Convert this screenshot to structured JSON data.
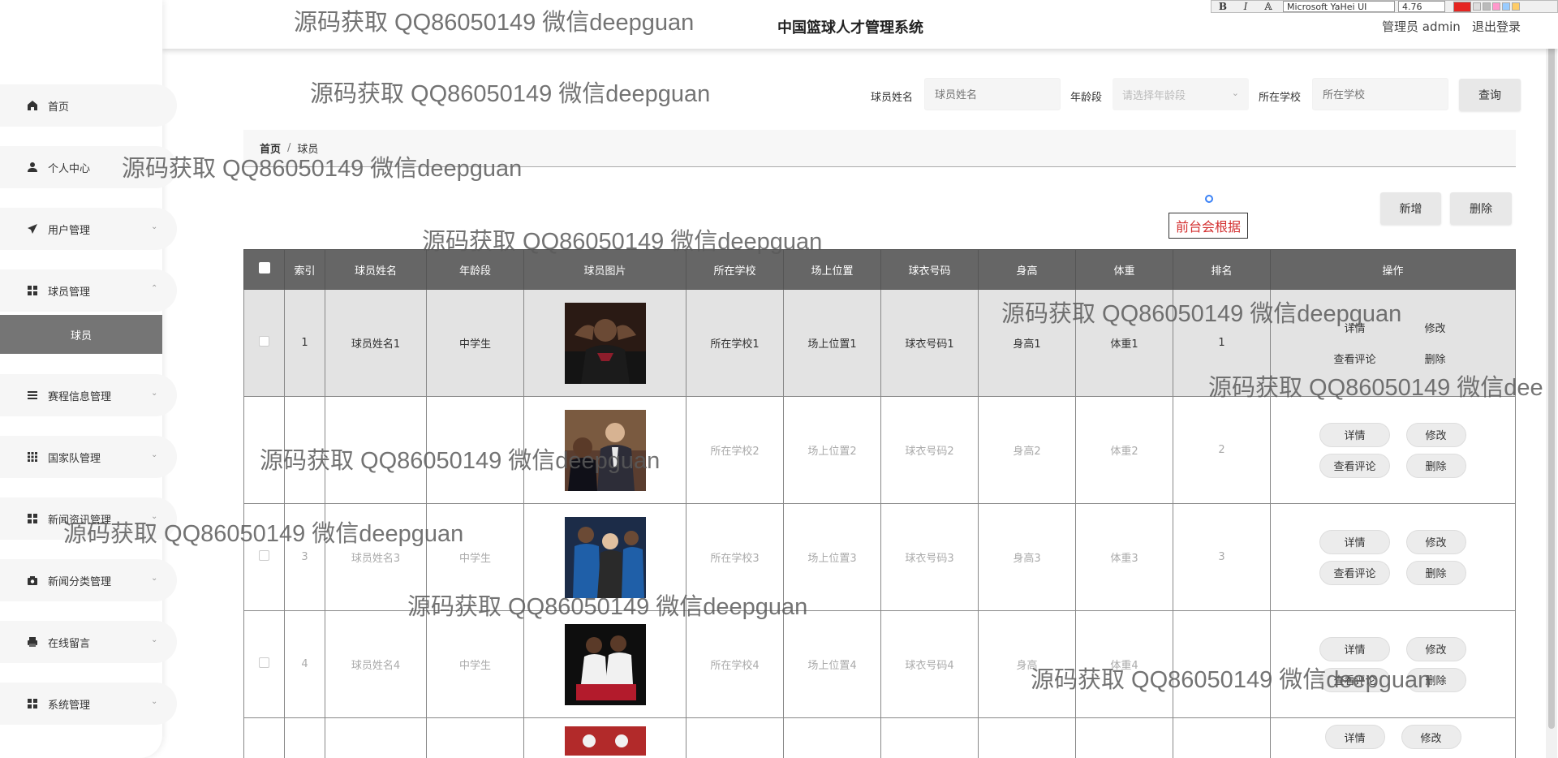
{
  "header": {
    "title": "中国篮球人才管理系统",
    "user": "管理员 admin",
    "logout": "退出登录"
  },
  "editor_toolbar": {
    "bold": "B",
    "italic": "I",
    "font": "Microsoft YaHei UI",
    "size": "4.76"
  },
  "sidebar": {
    "items": [
      {
        "label": "首页",
        "icon": "home-icon"
      },
      {
        "label": "个人中心",
        "icon": "user-icon"
      },
      {
        "label": "用户管理",
        "icon": "send-icon"
      },
      {
        "label": "球员管理",
        "icon": "grid-icon"
      },
      {
        "label": "赛程信息管理",
        "icon": "list-icon"
      },
      {
        "label": "国家队管理",
        "icon": "grid9-icon"
      },
      {
        "label": "新闻资讯管理",
        "icon": "grid-icon"
      },
      {
        "label": "新闻分类管理",
        "icon": "camera-icon"
      },
      {
        "label": "在线留言",
        "icon": "printer-icon"
      },
      {
        "label": "系统管理",
        "icon": "grid-icon"
      }
    ],
    "active_sub": "球员"
  },
  "search": {
    "name_label": "球员姓名",
    "name_placeholder": "球员姓名",
    "age_label": "年龄段",
    "age_placeholder": "请选择年龄段",
    "school_label": "所在学校",
    "school_placeholder": "所在学校",
    "query_button": "查询"
  },
  "breadcrumb": {
    "home": "首页",
    "separator": "/",
    "current": "球员"
  },
  "actions": {
    "add": "新增",
    "delete": "删除"
  },
  "note": "前台会根据",
  "table": {
    "headers": [
      "索引",
      "球员姓名",
      "年龄段",
      "球员图片",
      "所在学校",
      "场上位置",
      "球衣号码",
      "身高",
      "体重",
      "排名",
      "操作"
    ],
    "rows": [
      {
        "index": "1",
        "name": "球员姓名1",
        "age": "中学生",
        "school": "所在学校1",
        "position": "场上位置1",
        "jersey": "球衣号码1",
        "height": "身高1",
        "weight": "体重1",
        "rank": "1"
      },
      {
        "index": "",
        "name": "",
        "age": "",
        "school": "所在学校2",
        "position": "场上位置2",
        "jersey": "球衣号码2",
        "height": "身高2",
        "weight": "体重2",
        "rank": "2"
      },
      {
        "index": "3",
        "name": "球员姓名3",
        "age": "中学生",
        "school": "所在学校3",
        "position": "场上位置3",
        "jersey": "球衣号码3",
        "height": "身高3",
        "weight": "体重3",
        "rank": "3"
      },
      {
        "index": "4",
        "name": "球员姓名4",
        "age": "中学生",
        "school": "所在学校4",
        "position": "场上位置4",
        "jersey": "球衣号码4",
        "height": "身高",
        "weight": "体重4",
        "rank": ""
      }
    ],
    "ops": {
      "detail": "详情",
      "edit": "修改",
      "comments": "查看评论",
      "remove": "删除"
    }
  },
  "watermark": "源码获取 QQ86050149 微信deepguan",
  "watermark_partial": "源码获取 QQ86050149 微信dee",
  "colors": {
    "table_header": "#666666",
    "active_menu": "#757575",
    "note_text": "#d32f2f"
  }
}
